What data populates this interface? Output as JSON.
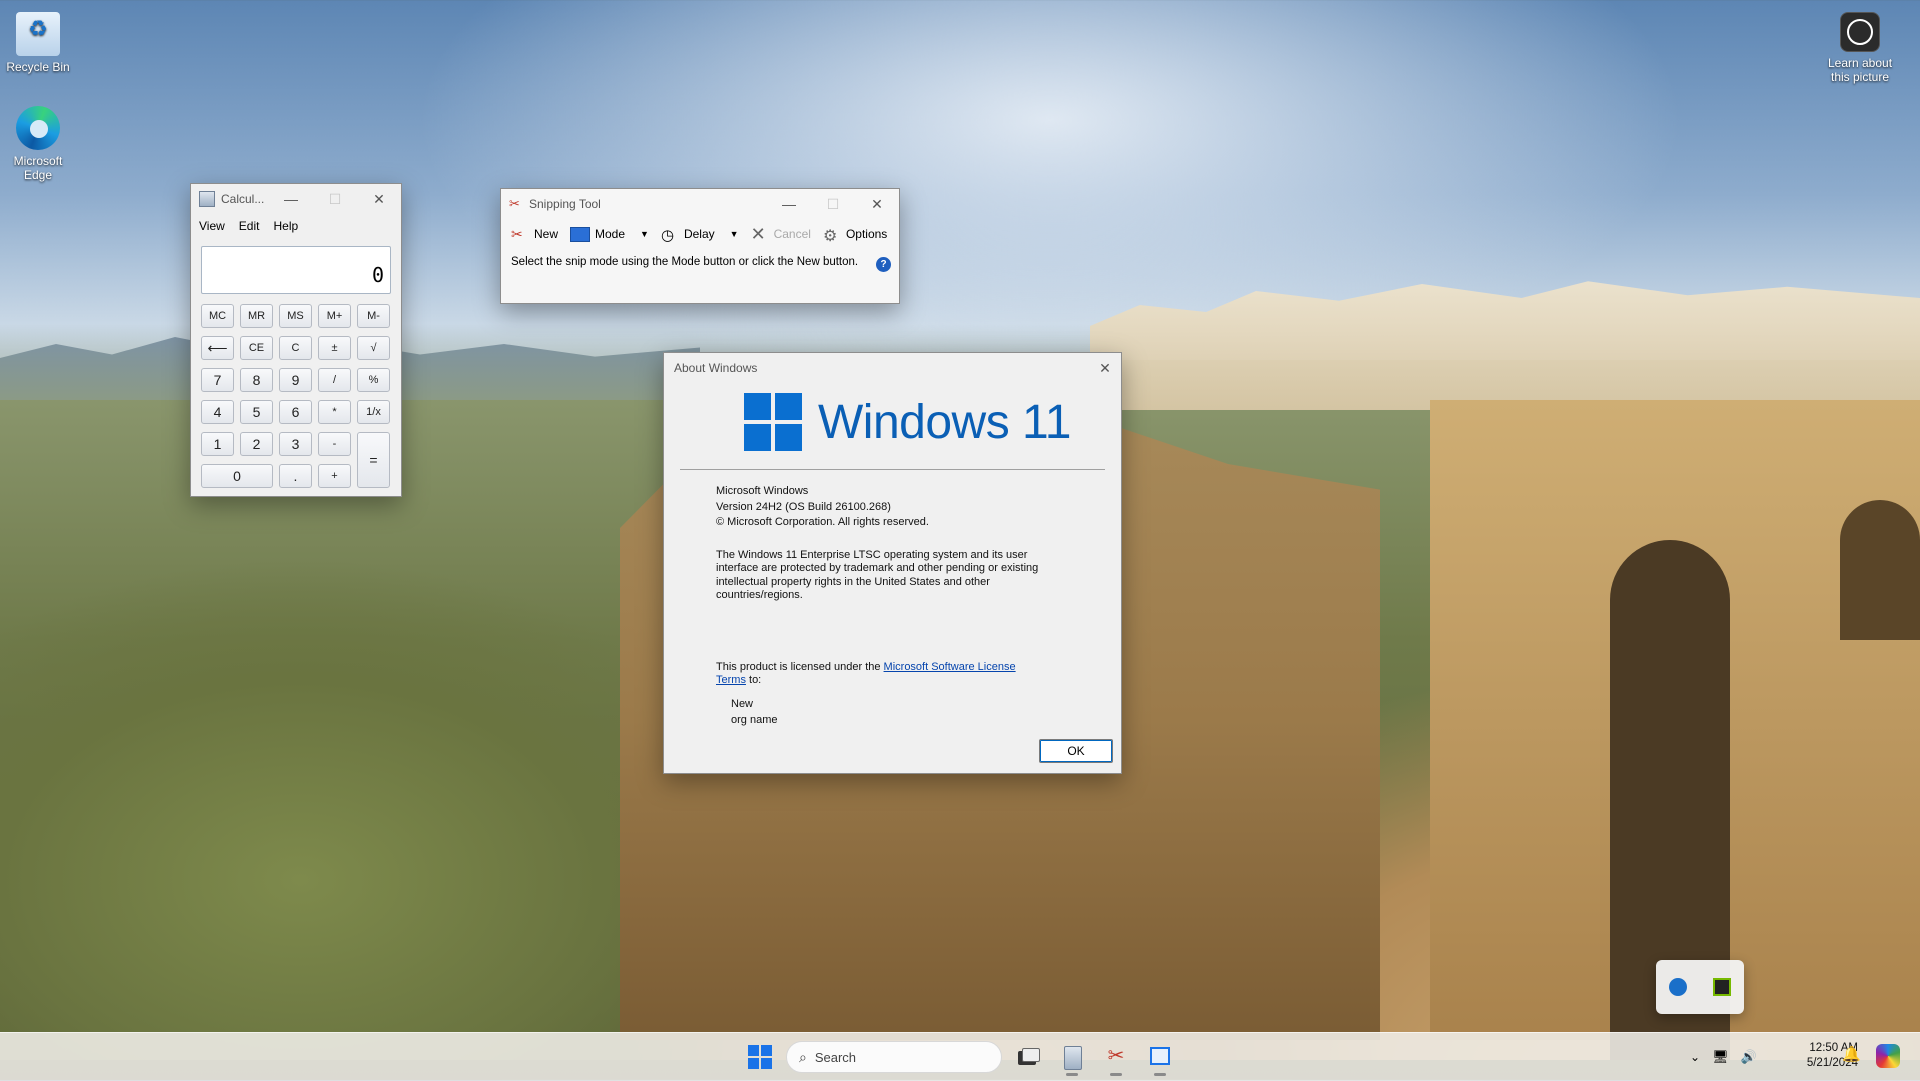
{
  "desktop": {
    "icons": [
      {
        "label": "Recycle Bin"
      },
      {
        "label": "Microsoft Edge"
      },
      {
        "label": "Learn about this picture"
      }
    ]
  },
  "calculator": {
    "title": "Calcul...",
    "menu": [
      "View",
      "Edit",
      "Help"
    ],
    "display": "0",
    "keys": {
      "mc": "MC",
      "mr": "MR",
      "ms": "MS",
      "mplus": "M+",
      "mminus": "M-",
      "back": "⟵",
      "ce": "CE",
      "c": "C",
      "pm": "±",
      "sqrt": "√",
      "k7": "7",
      "k8": "8",
      "k9": "9",
      "div": "/",
      "pct": "%",
      "k4": "4",
      "k5": "5",
      "k6": "6",
      "mul": "*",
      "inv": "1/x",
      "k1": "1",
      "k2": "2",
      "k3": "3",
      "sub": "-",
      "eq": "=",
      "k0": "0",
      "dot": ".",
      "add": "+"
    }
  },
  "snipping_tool": {
    "title": "Snipping Tool",
    "buttons": {
      "new": "New",
      "mode": "Mode",
      "delay": "Delay",
      "cancel": "Cancel",
      "options": "Options"
    },
    "message": "Select the snip mode using the Mode button or click the New button."
  },
  "about_windows": {
    "title": "About Windows",
    "brand": "Windows 11",
    "product": "Microsoft Windows",
    "version": "Version 24H2 (OS Build 26100.268)",
    "copyright": "© Microsoft Corporation. All rights reserved.",
    "legal": "The Windows 11 Enterprise LTSC operating system and its user interface are protected by trademark and other pending or existing intellectual property rights in the United States and other countries/regions.",
    "license_prefix": "This product is licensed under the ",
    "license_link": "Microsoft Software License Terms",
    "license_suffix": " to:",
    "licensee_user": "New",
    "licensee_org": "org name",
    "ok_label": "OK"
  },
  "taskbar": {
    "search_placeholder": "Search",
    "time": "12:50 AM",
    "date": "5/21/2024"
  },
  "colors": {
    "accent": "#0067c0",
    "brand_blue": "#0a5fb5",
    "link": "#0645ad"
  }
}
